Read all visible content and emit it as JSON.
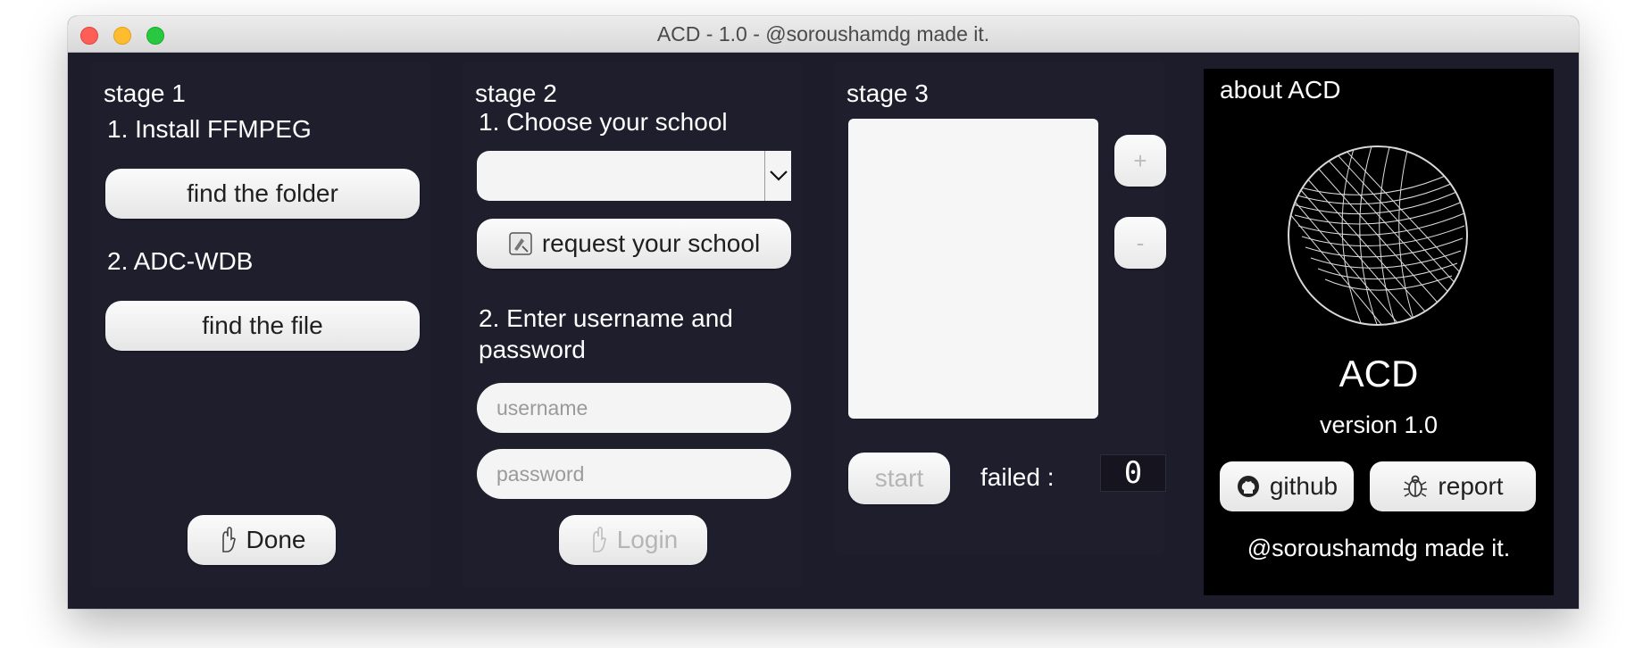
{
  "window": {
    "title": "ACD - 1.0 - @soroushamdg made it."
  },
  "stage1": {
    "title": "stage 1",
    "step1_label": "1. Install FFMPEG",
    "find_folder_label": "find the folder",
    "step2_label": "2. ADC-WDB",
    "find_file_label": "find the file",
    "done_label": "Done"
  },
  "stage2": {
    "title": "stage 2",
    "step1_label": "1. Choose your school",
    "school_select_value": "",
    "request_school_label": "request your school",
    "step2_label_line1": "2. Enter username and",
    "step2_label_line2": "password",
    "username_placeholder": "username",
    "password_placeholder": "password",
    "login_label": "Login"
  },
  "stage3": {
    "title": "stage 3",
    "add_label": "+",
    "remove_label": "-",
    "start_label": "start",
    "failed_label": "failed :",
    "failed_count": "0"
  },
  "about": {
    "title": "about ACD",
    "app_name": "ACD",
    "version": "version 1.0",
    "github_label": "github",
    "report_label": "report",
    "credit": "@soroushamdg made it."
  },
  "icons": {
    "done": "hand-icon",
    "request": "school-request-icon",
    "login": "hand-icon",
    "github": "github-icon",
    "report": "bug-icon",
    "logo": "acd-logo"
  }
}
